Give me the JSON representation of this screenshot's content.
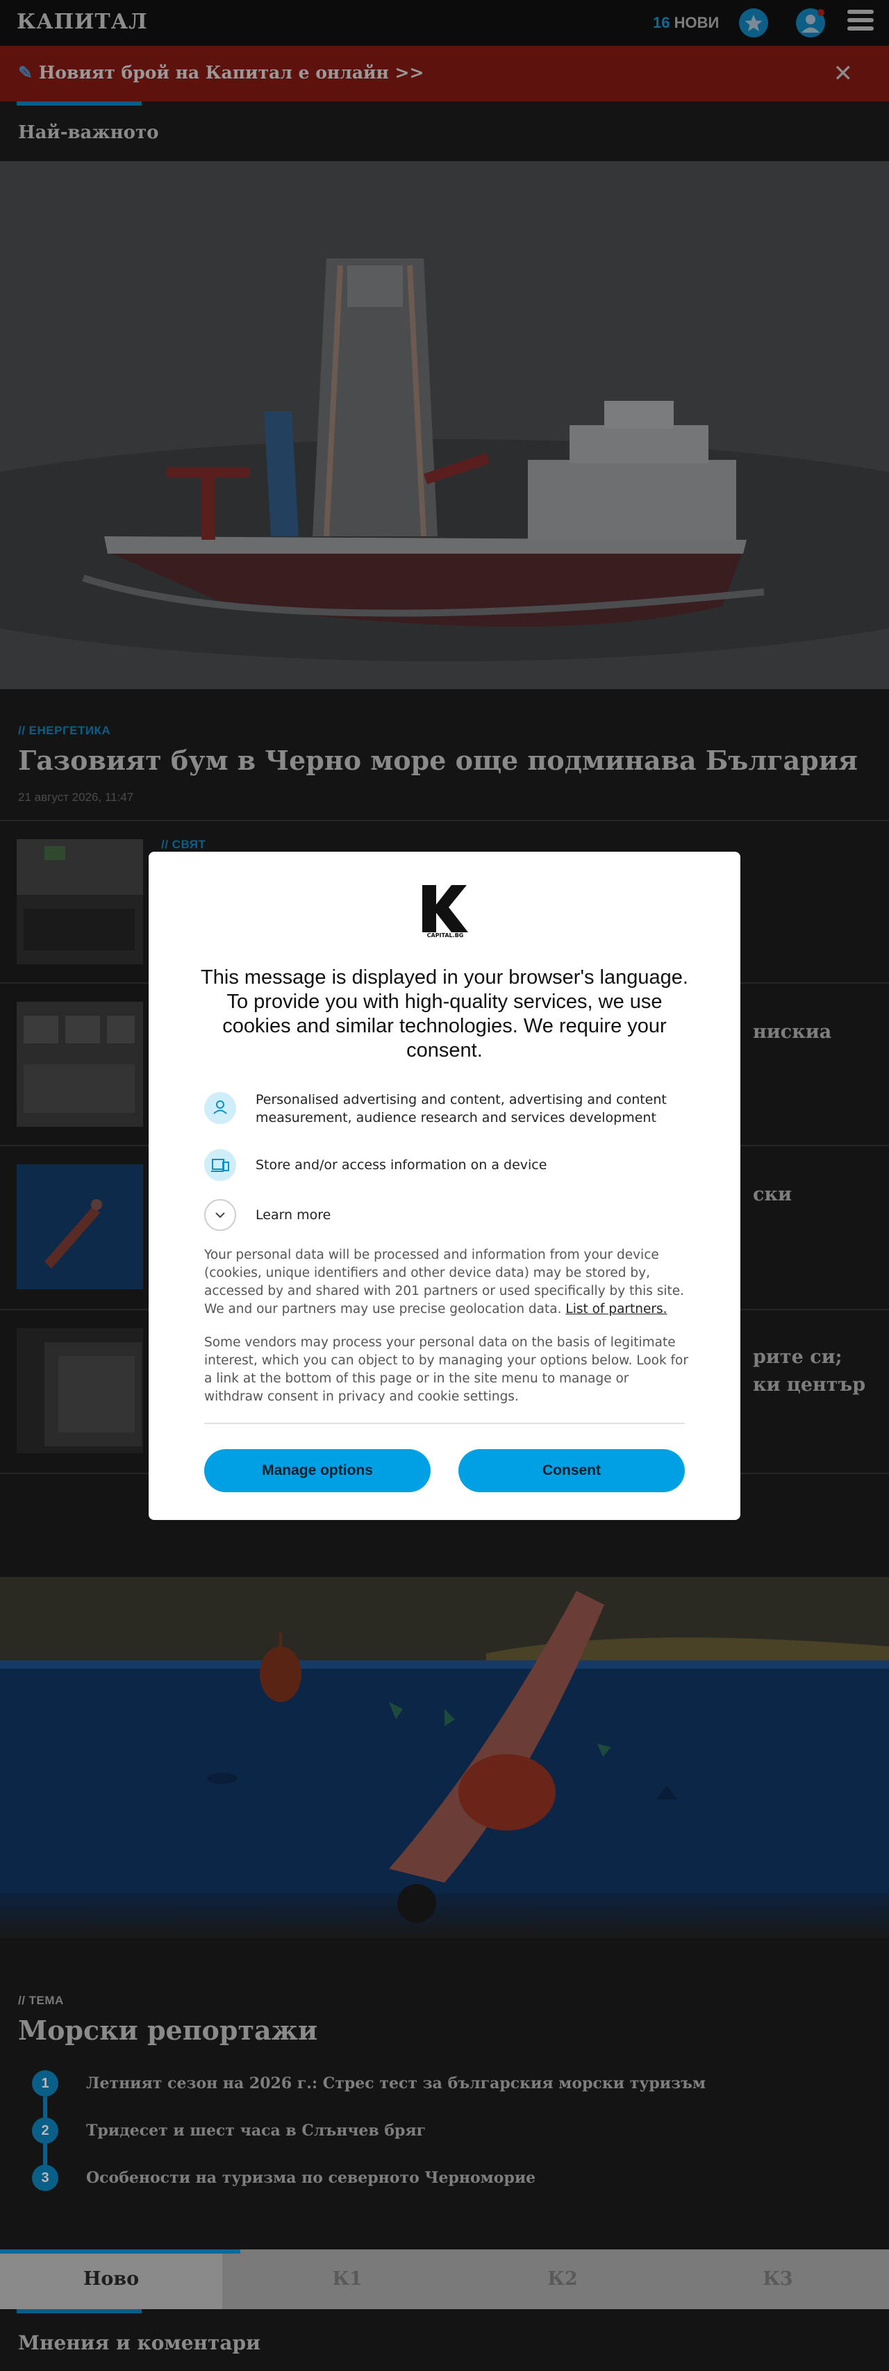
{
  "header": {
    "logo": "КАПИТАЛ",
    "new_count": "16",
    "new_label": "НОВИ",
    "icons": [
      "star-icon",
      "user-icon",
      "menu-icon"
    ]
  },
  "promo": {
    "text": "Новият брой на Капитал е онлайн >>",
    "close": "✕"
  },
  "top_section": {
    "title": "Най-важното"
  },
  "hero": {
    "kicker": "// ЕНЕРГЕТИКА",
    "title": "Газовият бум в Черно море още подминава България",
    "date": "21 август 2026, 11:47"
  },
  "articles": [
    {
      "kicker": "// СВЯТ",
      "title_fragment": ""
    },
    {
      "kicker": "",
      "title_fragment": "нискиа"
    },
    {
      "kicker": "",
      "title_fragment": "ски"
    },
    {
      "kicker": "",
      "title_fragment": "рите си;",
      "title_fragment_2": "ки център"
    }
  ],
  "theme": {
    "kicker": "// ТЕМА",
    "title": "Морски репортажи",
    "items": [
      {
        "num": "1",
        "text": "Летният сезон на 2026 г.: Стрес тест за българския морски туризъм"
      },
      {
        "num": "2",
        "text": "Тридесет и шест часа в Слънчев бряг"
      },
      {
        "num": "3",
        "text": "Особености на туризма по северното Черноморие"
      }
    ]
  },
  "tabs": [
    {
      "label": "Ново",
      "active": true
    },
    {
      "label": "К1",
      "active": false
    },
    {
      "label": "К2",
      "active": false
    },
    {
      "label": "К3",
      "active": false
    }
  ],
  "opinion_section": {
    "title": "Мнения и коментари"
  },
  "consent": {
    "logo_text": "CAPITAL.BG",
    "heading": "This message is displayed in your browser's language. To provide you with high-quality services, we use cookies and similar technologies. We require your consent.",
    "purposes": [
      {
        "icon": "person-icon",
        "text": "Personalised advertising and content, advertising and content measurement, audience research and services development"
      },
      {
        "icon": "devices-icon",
        "text": "Store and/or access information on a device"
      }
    ],
    "learn_more": "Learn more",
    "paragraph_1": "Your personal data will be processed and information from your device (cookies, unique identifiers and other device data) may be stored by, accessed by and shared with 201 partners or used specifically by this site. We and our partners may use precise geolocation data.",
    "partners_link": "List of partners.",
    "paragraph_2": "Some vendors may process your personal data on the basis of legitimate interest, which you can object to by managing your options below. Look for a link at the bottom of this page or in the site menu to manage or withdraw consent in privacy and cookie settings.",
    "manage_button": "Manage options",
    "consent_button": "Consent"
  },
  "colors": {
    "accent": "#00a1e4",
    "brand_dim": "#0a5f88",
    "promo_bg": "#5e120d"
  }
}
